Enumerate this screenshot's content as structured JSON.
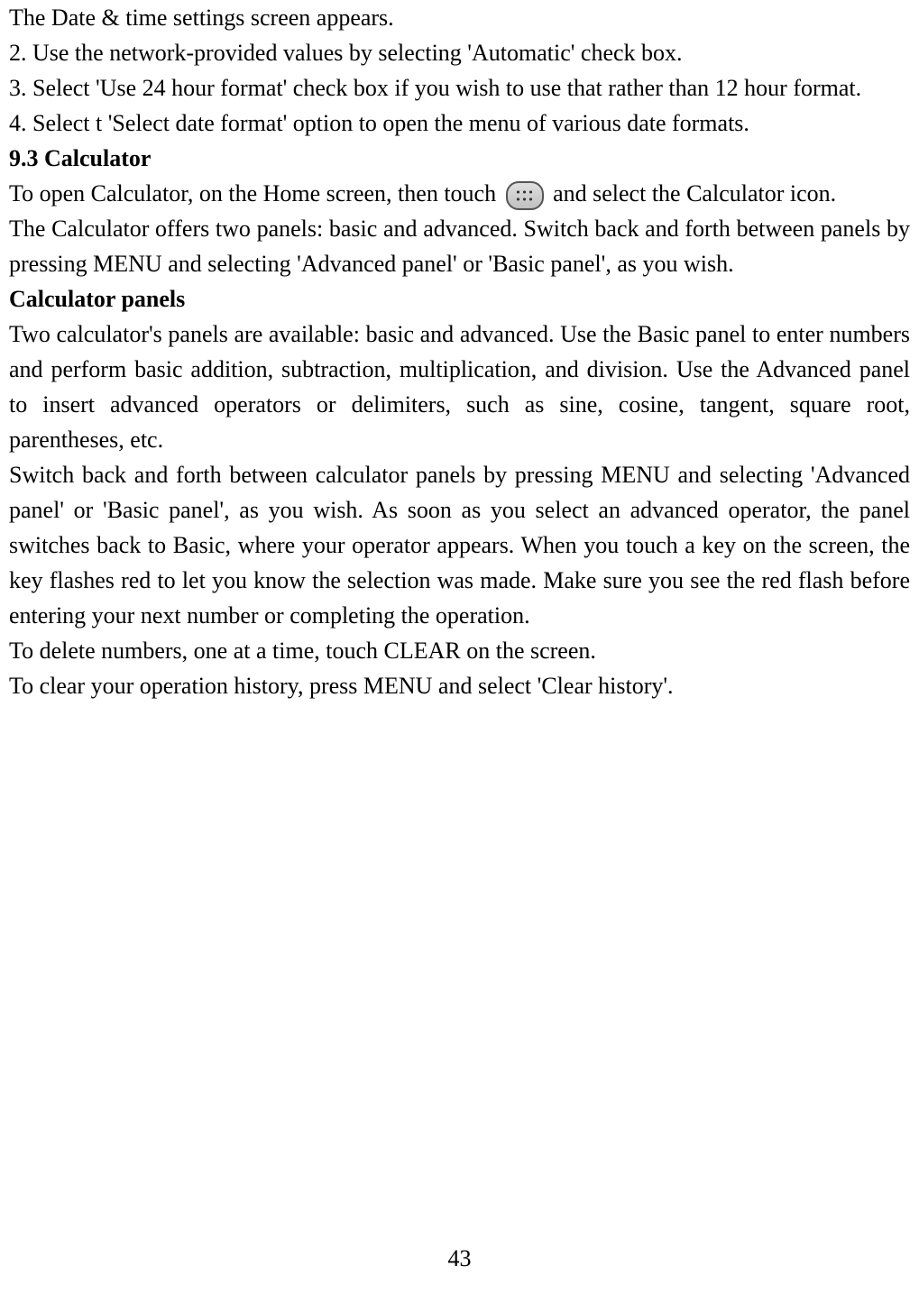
{
  "lines": {
    "l1": "The Date & time settings screen appears.",
    "l2": "2. Use the network-provided values by selecting 'Automatic' check box.",
    "l3": "3. Select 'Use 24 hour format' check box if you wish to use that rather than 12 hour format.",
    "l4": "4. Select t 'Select date format' option to open the menu of various date formats.",
    "heading1": "9.3 Calculator",
    "calc_open_before": "To open Calculator, on the Home screen, then touch ",
    "calc_open_after": " and select the Calculator icon.",
    "calc_panels1": "The Calculator offers two panels: basic and advanced. Switch back and forth between panels by pressing MENU and selecting 'Advanced panel' or 'Basic panel', as you wish.",
    "heading2": "Calculator panels",
    "panels_desc1": "Two calculator's panels are available: basic and advanced. Use the Basic panel to enter numbers and perform basic addition, subtraction, multiplication, and division. Use the Advanced panel to insert advanced operators or delimiters, such as sine, cosine, tangent, square root, parentheses, etc.",
    "panels_desc2": "Switch back and forth between calculator panels by pressing MENU and selecting 'Advanced panel' or 'Basic panel', as you wish. As soon as you select an advanced operator, the panel switches back to Basic, where your operator appears. When you touch a key on the screen, the key flashes red to let you know the selection was made. Make sure you see the red flash before entering your next number or completing the operation.",
    "delete_line": "To delete numbers, one at a time, touch CLEAR on the screen.",
    "clear_history": "To clear your operation history, press MENU and select 'Clear history'."
  },
  "page_number": "43"
}
